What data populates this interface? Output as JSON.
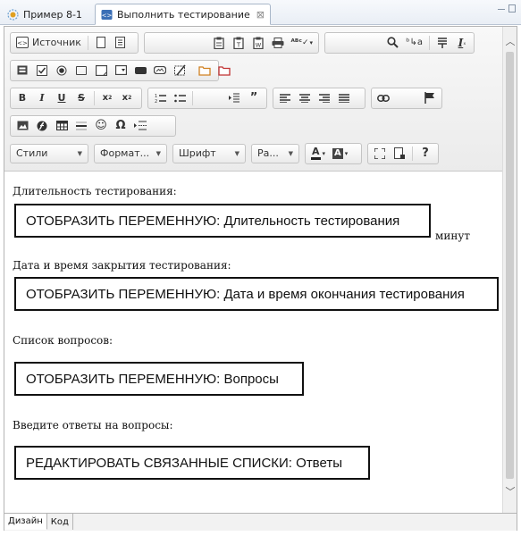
{
  "tabs": [
    {
      "label": "Пример 8-1",
      "active": false,
      "icon": "process-icon"
    },
    {
      "label": "Выполнить тестирование",
      "active": true,
      "icon": "form-icon"
    }
  ],
  "toolbar": {
    "source_label": "Источник",
    "styles_label": "Стили",
    "format_label": "Формат...",
    "font_label": "Шрифт",
    "size_label": "Ра...",
    "help_label": "?"
  },
  "content": {
    "p1": "Длительность тестирования:",
    "v1": "ОТОБРАЗИТЬ ПЕРЕМЕННУЮ: Длительность тестирования",
    "unit1": "минут",
    "p2": "Дата и время закрытия тестирования:",
    "v2": "ОТОБРАЗИТЬ ПЕРЕМЕННУЮ: Дата и время окончания тестирования",
    "p3": "Список вопросов:",
    "v3": "ОТОБРАЗИТЬ ПЕРЕМЕННУЮ: Вопросы",
    "p4": "Введите ответы на вопросы:",
    "v4": "РЕДАКТИРОВАТЬ СВЯЗАННЫЕ СПИСКИ: Ответы"
  },
  "bottom_tabs": [
    {
      "label": "Дизайн",
      "active": true
    },
    {
      "label": "Код",
      "active": false
    }
  ],
  "colors": {
    "tab_border": "#a9b7c9",
    "toolbar_bg": "#ebebeb",
    "box_border": "#111111"
  }
}
